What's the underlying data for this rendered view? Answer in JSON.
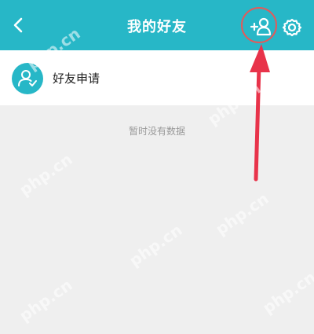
{
  "header": {
    "title": "我的好友",
    "back_icon": "chevron-left-icon",
    "add_friend_icon": "add-user-icon",
    "settings_icon": "gear-icon",
    "bg_color": "#27b7c7"
  },
  "friend_requests": {
    "label": "好友申请",
    "icon": "user-check-icon"
  },
  "empty_state": "暂时没有数据",
  "annotation": {
    "circle_color": "#e35a5a",
    "arrow_color": "#e8334a"
  },
  "watermark": "php.cn"
}
